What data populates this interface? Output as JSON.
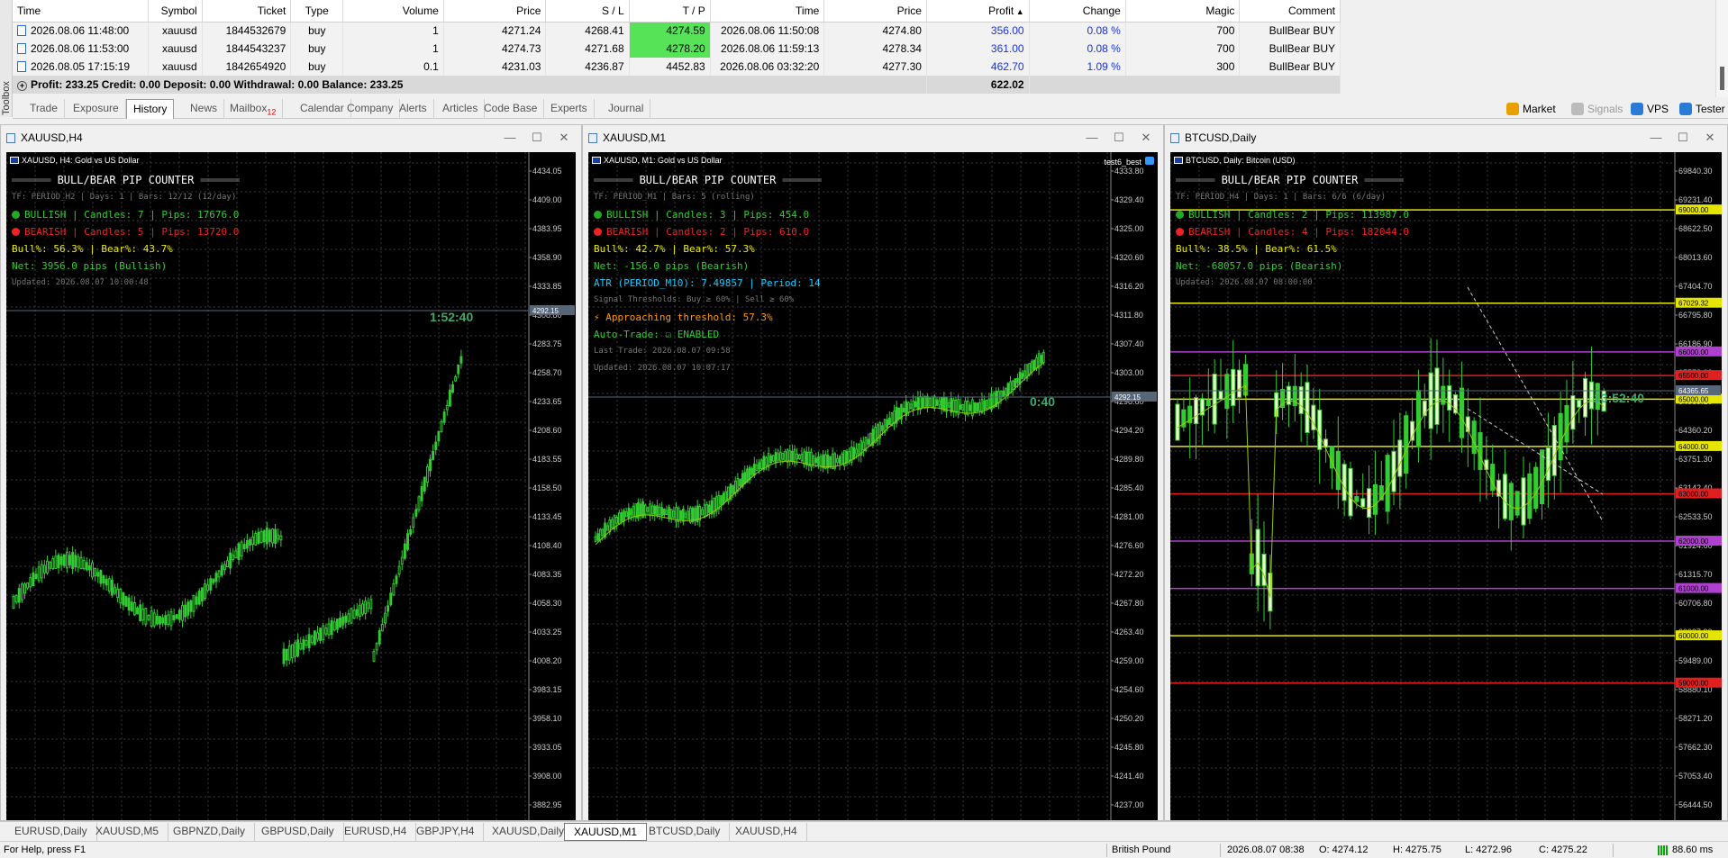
{
  "toolbox": {
    "label": "Toolbox"
  },
  "trades": {
    "columns": [
      "Time",
      "Symbol",
      "Ticket",
      "Type",
      "Volume",
      "Price",
      "S / L",
      "T / P",
      "Time",
      "Price",
      "Profit",
      "Change",
      "Magic",
      "Comment"
    ],
    "sort_indicator": "▲",
    "rows": [
      {
        "open_time": "2026.08.06 11:48:00",
        "symbol": "xauusd",
        "ticket": "1844532679",
        "type": "buy",
        "volume": "1",
        "price": "4271.24",
        "sl": "4268.41",
        "tp": "4274.59",
        "close_time": "2026.08.06 11:50:08",
        "close_price": "4274.80",
        "profit": "356.00",
        "change": "0.08 %",
        "magic": "700",
        "comment": "BullBear BUY"
      },
      {
        "open_time": "2026.08.06 11:53:00",
        "symbol": "xauusd",
        "ticket": "1844543237",
        "type": "buy",
        "volume": "1",
        "price": "4274.73",
        "sl": "4271.68",
        "tp": "4278.20",
        "close_time": "2026.08.06 11:59:13",
        "close_price": "4278.34",
        "profit": "361.00",
        "change": "0.08 %",
        "magic": "700",
        "comment": "BullBear BUY"
      },
      {
        "open_time": "2026.08.05 17:15:19",
        "symbol": "xauusd",
        "ticket": "1842654920",
        "type": "buy",
        "volume": "0.1",
        "price": "4231.03",
        "sl": "4236.87",
        "tp": "4452.83",
        "close_time": "2026.08.06 03:32:20",
        "close_price": "4277.30",
        "profit": "462.70",
        "change": "1.09 %",
        "magic": "300",
        "comment": "BullBear BUY"
      }
    ],
    "summary": "Profit: 233.25  Credit: 0.00  Deposit: 0.00  Withdrawal: 0.00  Balance: 233.25",
    "total_profit": "622.02"
  },
  "tabs": [
    {
      "label": "Trade"
    },
    {
      "label": "Exposure"
    },
    {
      "label": "History",
      "active": true
    },
    {
      "label": "News"
    },
    {
      "label": "Mailbox",
      "badge": "12"
    },
    {
      "label": "Calendar"
    },
    {
      "label": "Company"
    },
    {
      "label": "Alerts"
    },
    {
      "label": "Articles"
    },
    {
      "label": "Code Base"
    },
    {
      "label": "Experts"
    },
    {
      "label": "Journal"
    }
  ],
  "right_tabs": [
    {
      "label": "Market",
      "icon": "market-icon"
    },
    {
      "label": "Signals",
      "icon": "signals-icon"
    },
    {
      "label": "VPS",
      "icon": "vps-icon"
    },
    {
      "label": "Tester",
      "icon": "tester-icon"
    }
  ],
  "window_controls": {
    "min": "—",
    "max": "☐",
    "close": "✕"
  },
  "charts": [
    {
      "title": "XAUUSD,H4",
      "symbol_desc": "XAUUSD, H4:  Gold vs US Dollar",
      "expert": "",
      "panel": {
        "header": "BULL/BEAR PIP COUNTER",
        "tf": "TF: PERIOD_H2 | Days: 1 | Bars: 12/12 (12/day)",
        "bull": "BULLISH  |  Candles: 7   |  Pips: 17676.0",
        "bear": "BEARISH  |  Candles: 5   |  Pips: 13720.0",
        "pct": "Bull%: 56.3%  |  Bear%: 43.7%",
        "net": "Net: 3956.0 pips (Bullish)",
        "updated": "Updated: 2026.08.07 10:00:48"
      },
      "countdown": "1:52:40",
      "current_price": "4292.15",
      "price_scale": [
        "4434.05",
        "4409.00",
        "4383.95",
        "4358.90",
        "4333.85",
        "4308.80",
        "4283.75",
        "4258.70",
        "4233.65",
        "4208.60",
        "4183.55",
        "4158.50",
        "4133.45",
        "4108.40",
        "4083.35",
        "4058.30",
        "4033.25",
        "4008.20",
        "3983.15",
        "3958.10",
        "3933.05",
        "3908.00",
        "3882.95"
      ]
    },
    {
      "title": "XAUUSD,M1",
      "symbol_desc": "XAUUSD, M1:  Gold vs US Dollar",
      "expert": "test6_best",
      "panel": {
        "header": "BULL/BEAR PIP COUNTER",
        "tf": "TF: PERIOD_M1 | Bars: 5 (rolling)",
        "bull": "BULLISH  |  Candles: 3   |  Pips: 454.0",
        "bear": "BEARISH  |  Candles: 2   |  Pips: 610.0",
        "pct": "Bull%: 42.7%  |  Bear%: 57.3%",
        "net": "Net: -156.0 pips (Bearish)",
        "atr": "ATR (PERIOD_M10): 7.49857 | Period: 14",
        "thresholds": "Signal Thresholds: Buy ≥ 60% | Sell ≥ 60%",
        "approach": "⚡ Approaching threshold: 57.3%",
        "autotrade": "Auto-Trade: ☑ ENABLED",
        "lasttrade": "Last Trade: 2026.08.07 09:58",
        "updated": "Updated: 2026.08.07 10:07:17"
      },
      "countdown": "0:40",
      "current_price": "4292.15",
      "price_scale": [
        "4333.80",
        "4329.40",
        "4325.00",
        "4320.60",
        "4316.20",
        "4311.80",
        "4307.40",
        "4303.00",
        "4298.60",
        "4294.20",
        "4289.80",
        "4285.40",
        "4281.00",
        "4276.60",
        "4272.20",
        "4267.80",
        "4263.40",
        "4259.00",
        "4254.60",
        "4250.20",
        "4245.80",
        "4241.40",
        "4237.00"
      ]
    },
    {
      "title": "BTCUSD,Daily",
      "symbol_desc": "BTCUSD, Daily:  Bitcoin (USD)",
      "expert": "",
      "panel": {
        "header": "BULL/BEAR PIP COUNTER",
        "tf": "TF: PERIOD_H4 | Days: 1 | Bars: 6/6 (6/day)",
        "bull": "BULLISH  |  Candles: 2   |  Pips: 113987.0",
        "bear": "BEARISH  |  Candles: 4   |  Pips: 182044.0",
        "pct": "Bull%: 38.5%  |  Bear%: 61.5%",
        "net": "Net: -68057.0 pips (Bearish)",
        "updated": "Updated: 2026.08.07 08:00:00"
      },
      "countdown": "13:52:40",
      "current_price": "64365.65",
      "price_scale": [
        "69840.30",
        "69231.40",
        "68622.50",
        "68013.60",
        "67404.70",
        "66795.80",
        "66186.90",
        "65578.00",
        "64969.10",
        "64360.20",
        "63751.30",
        "63142.40",
        "62533.50",
        "61924.60",
        "61315.70",
        "60706.80",
        "60097.90",
        "59489.00",
        "58880.10",
        "58271.20",
        "57662.30",
        "57053.40",
        "56444.50"
      ],
      "levels": [
        {
          "value": "69000.00",
          "color": "#e5e500"
        },
        {
          "value": "67029.32",
          "color": "#e5e500"
        },
        {
          "value": "66000.00",
          "color": "#b040d0"
        },
        {
          "value": "65500.00",
          "color": "#e02020"
        },
        {
          "value": "65000.00",
          "color": "#e5e500"
        },
        {
          "value": "64000.00",
          "color": "#e5e500"
        },
        {
          "value": "63000.00",
          "color": "#e02020"
        },
        {
          "value": "62000.00",
          "color": "#b040d0"
        },
        {
          "value": "61000.00",
          "color": "#b040d0"
        },
        {
          "value": "60000.00",
          "color": "#e5e500"
        },
        {
          "value": "59000.00",
          "color": "#e02020"
        }
      ]
    }
  ],
  "symbol_tabs": [
    {
      "label": "EURUSD,Daily"
    },
    {
      "label": "XAUUSD,M5"
    },
    {
      "label": "GBPNZD,Daily"
    },
    {
      "label": "GBPUSD,Daily"
    },
    {
      "label": "EURUSD,H4"
    },
    {
      "label": "GBPJPY,H4"
    },
    {
      "label": "XAUUSD,Daily"
    },
    {
      "label": "XAUUSD,M1",
      "active": true
    },
    {
      "label": "BTCUSD,Daily"
    },
    {
      "label": "XAUUSD,H4"
    }
  ],
  "status": {
    "help": "For Help, press F1",
    "profile": "British Pound",
    "datetime": "2026.08.07 08:38",
    "open": "O: 4274.12",
    "high": "H: 4275.75",
    "low": "L: 4272.96",
    "close": "C: 4275.22",
    "ping": "88.60 ms"
  },
  "colors": {
    "bull": "#33cc33",
    "bear": "#e02222",
    "tp_hit": "#57e357",
    "blue": "#1a33d8"
  }
}
